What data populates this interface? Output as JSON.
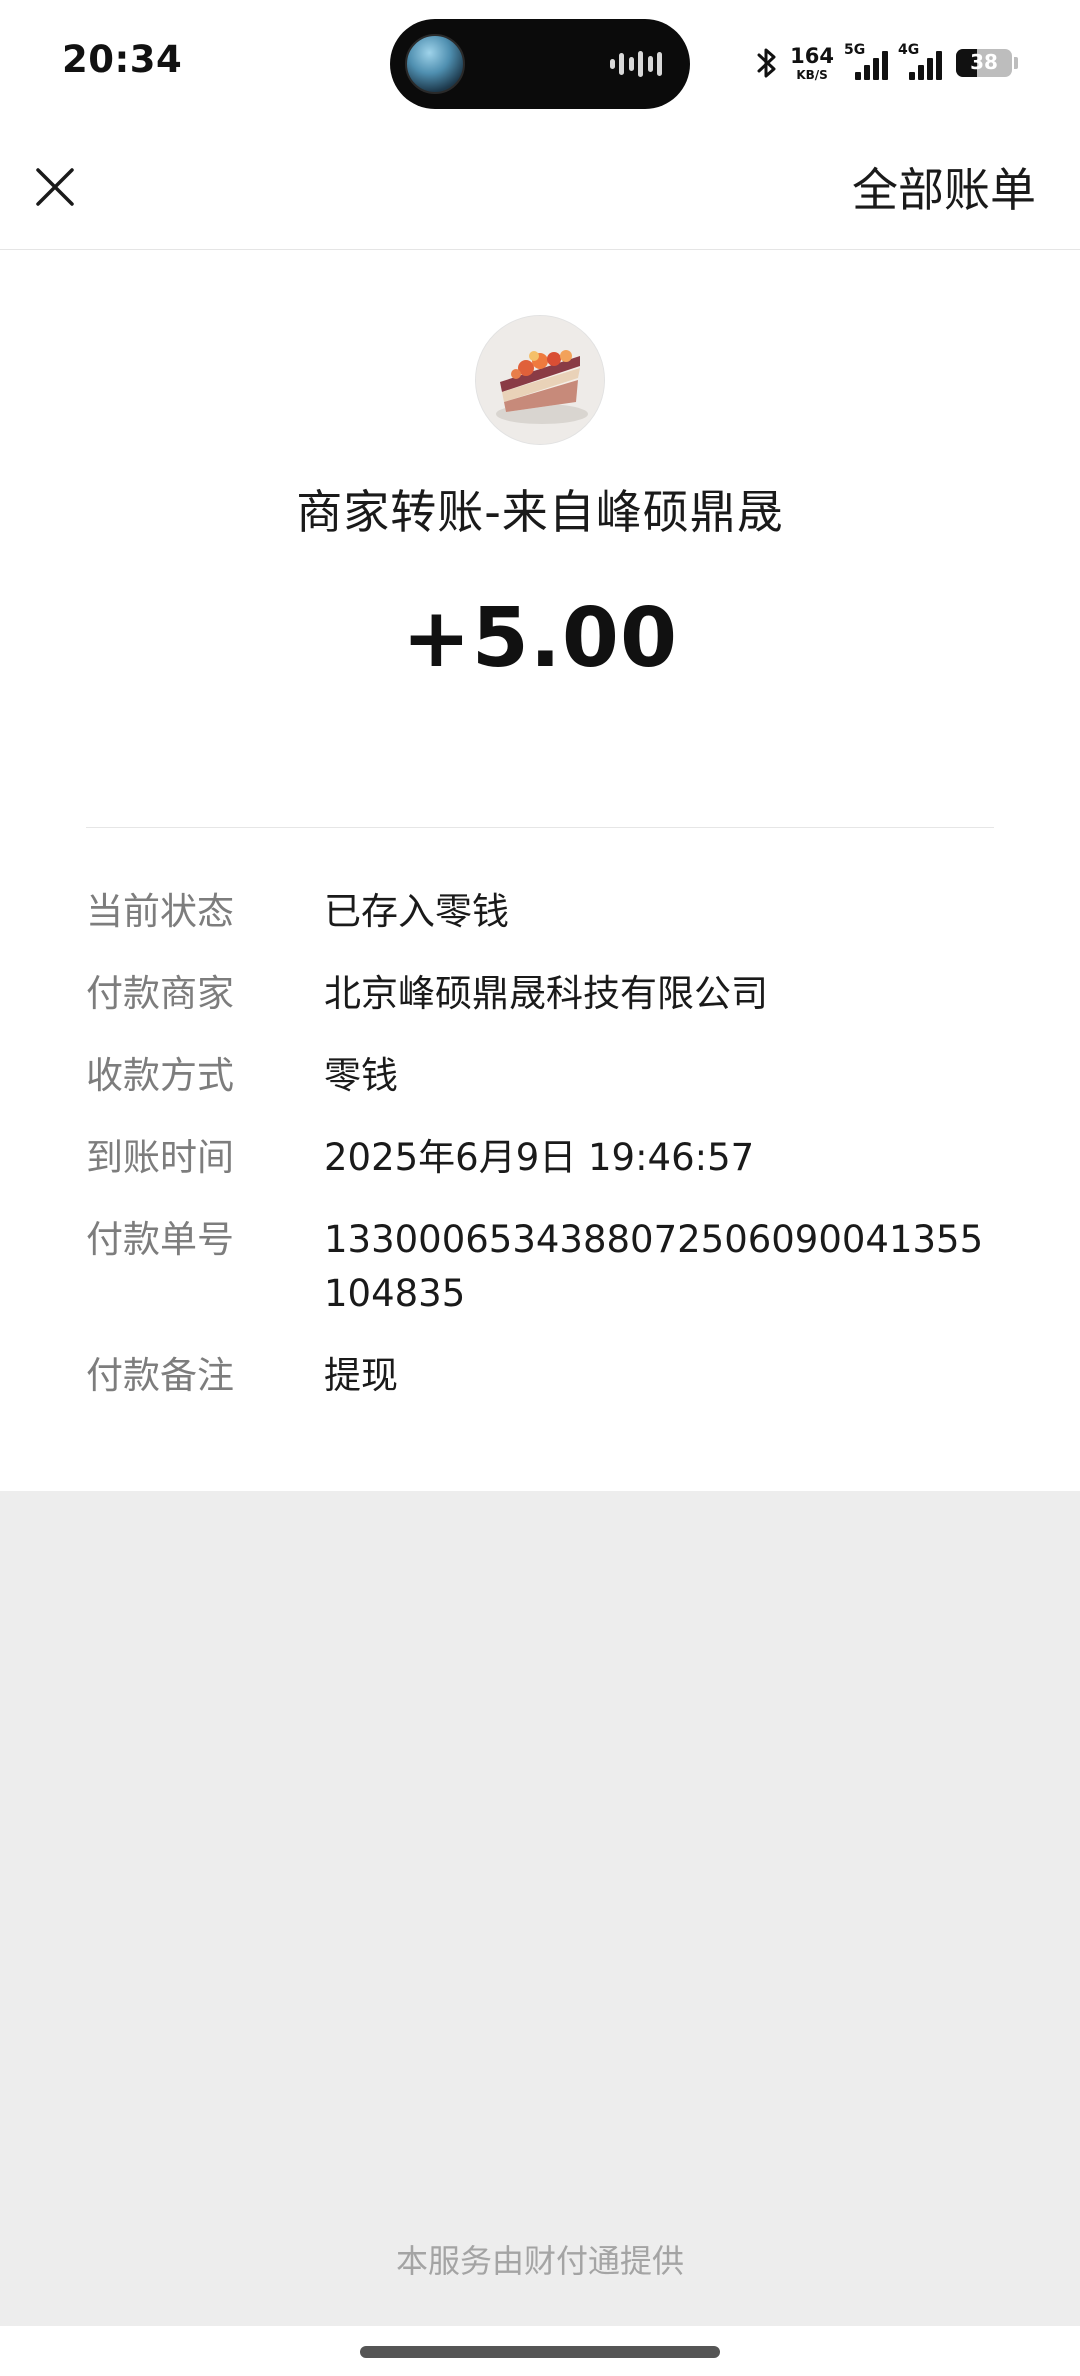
{
  "status_bar": {
    "time": "20:34",
    "net_speed_value": "164",
    "net_speed_unit": "KB/S",
    "signal_1_label": "5G",
    "signal_2_label": "4G",
    "battery_percent": "38"
  },
  "nav": {
    "close_icon": "close-icon",
    "all_bills_label": "全部账单"
  },
  "transaction": {
    "title": "商家转账-来自峰硕鼎晟",
    "amount": "+5.00",
    "details": [
      {
        "key": "当前状态",
        "value": "已存入零钱"
      },
      {
        "key": "付款商家",
        "value": "北京峰硕鼎晟科技有限公司"
      },
      {
        "key": "收款方式",
        "value": "零钱"
      },
      {
        "key": "到账时间",
        "value": "2025年6月9日 19:46:57"
      },
      {
        "key": "付款单号",
        "value": "1330006534388072506090041355104835"
      },
      {
        "key": "付款备注",
        "value": "提现"
      }
    ]
  },
  "footer": {
    "provider_text": "本服务由财付通提供"
  }
}
